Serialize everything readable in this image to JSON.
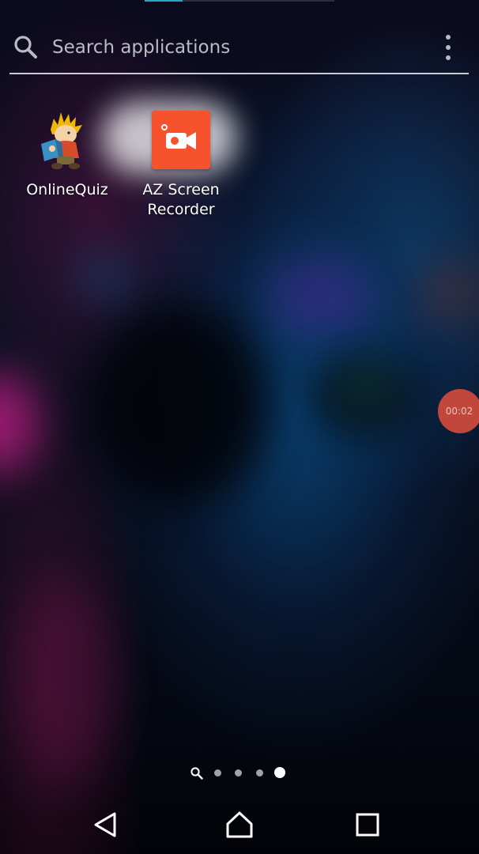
{
  "search": {
    "placeholder": "Search applications",
    "value": ""
  },
  "top_indicator": {
    "progress": 0.2,
    "color": "#22a9c8"
  },
  "apps": [
    {
      "label": "OnlineQuiz",
      "icon": "cartoon-boy-reading-icon"
    },
    {
      "label": "AZ Screen Recorder",
      "icon": "video-camera-icon",
      "tile_color": "#f5522d"
    }
  ],
  "record_bubble": {
    "timer": "00:02",
    "color": "#d14b3c"
  },
  "pager": {
    "page_count": 4,
    "active_page": 4
  },
  "nav": {
    "buttons": [
      "back-icon",
      "home-icon",
      "recents-icon"
    ]
  }
}
